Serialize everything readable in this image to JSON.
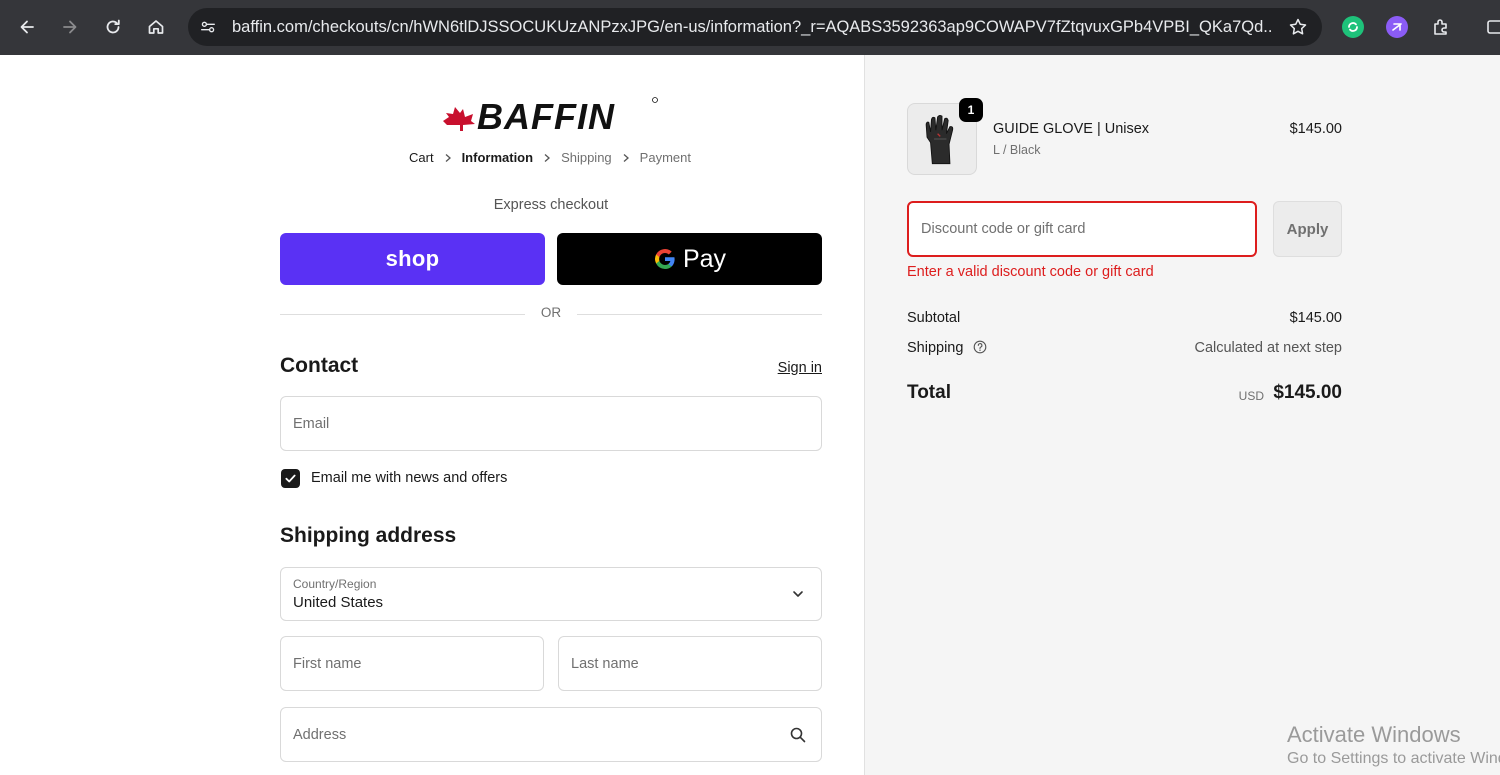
{
  "browser": {
    "url": "baffin.com/checkouts/cn/hWN6tlDJSSOCUKUzANPzxJPG/en-us/information?_r=AQABS3592363ap9COWAPV7fZtqvuxGPb4VPBI_QKa7Qd...",
    "icons": [
      "back-icon",
      "forward-icon",
      "reload-icon",
      "home-icon",
      "site-info-icon",
      "bookmark-star-icon",
      "extension-icon"
    ]
  },
  "brand": {
    "logo_text": "BAFFIN",
    "accent": "#c8102e"
  },
  "breadcrumb": [
    {
      "label": "Cart"
    },
    {
      "label": "Information"
    },
    {
      "label": "Shipping"
    },
    {
      "label": "Payment"
    }
  ],
  "express": {
    "title": "Express checkout",
    "shop_label": "shop",
    "gpay_label": "Pay",
    "or_label": "OR",
    "shop_color": "#5a31f4"
  },
  "contact": {
    "heading": "Contact",
    "signin_label": "Sign in",
    "email_placeholder": "Email",
    "newsletter_label": "Email me with news and offers",
    "newsletter_checked": true
  },
  "shipping": {
    "heading": "Shipping address",
    "country_label": "Country/Region",
    "country_value": "United States",
    "first_name_placeholder": "First name",
    "last_name_placeholder": "Last name",
    "address_placeholder": "Address"
  },
  "summary": {
    "product": {
      "quantity": "1",
      "name": "GUIDE GLOVE | Unisex",
      "variant": "L / Black",
      "price": "$145.00"
    },
    "discount_placeholder": "Discount code or gift card",
    "apply_label": "Apply",
    "discount_error": "Enter a valid discount code or gift card",
    "error_color": "#dd1d1d",
    "subtotal_label": "Subtotal",
    "subtotal_value": "$145.00",
    "shipping_label": "Shipping",
    "shipping_value": "Calculated at next step",
    "total_label": "Total",
    "total_currency": "USD",
    "total_value": "$145.00"
  },
  "watermark": {
    "line1": "Activate Windows",
    "line2": "Go to Settings to activate Windows."
  }
}
